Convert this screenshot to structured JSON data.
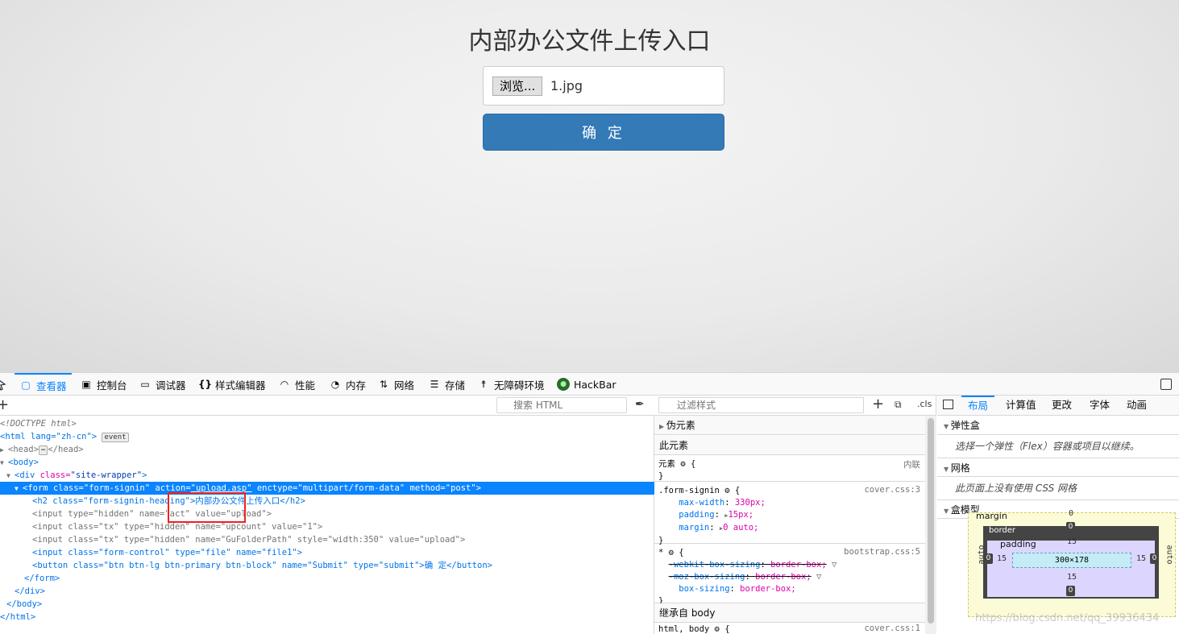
{
  "page": {
    "title": "内部办公文件上传入口",
    "browse_label": "浏览...",
    "file_name": "1.jpg",
    "submit_label": "确 定"
  },
  "devtools": {
    "tabs": [
      {
        "label": "查看器",
        "icon": "inspector-icon"
      },
      {
        "label": "控制台",
        "icon": "console-icon"
      },
      {
        "label": "调试器",
        "icon": "debugger-icon"
      },
      {
        "label": "样式编辑器",
        "icon": "style-editor-icon"
      },
      {
        "label": "性能",
        "icon": "performance-icon"
      },
      {
        "label": "内存",
        "icon": "memory-icon"
      },
      {
        "label": "网络",
        "icon": "network-icon"
      },
      {
        "label": "存储",
        "icon": "storage-icon"
      },
      {
        "label": "无障碍环境",
        "icon": "accessibility-icon"
      },
      {
        "label": "HackBar",
        "icon": "hackbar-icon"
      }
    ],
    "html_search_placeholder": "搜索 HTML",
    "html_tree": {
      "doctype": "<!DOCTYPE html>",
      "html_open": "<html lang=\"zh-cn\">",
      "event_badge": "event",
      "head_line": "<head>",
      "head_close": "</head>",
      "body_open": "<body>",
      "div_open_tag": "<div ",
      "div_attr": "class=",
      "div_val": "\"site-wrapper\"",
      "form_tag": "<form ",
      "form_class_attr": "class=",
      "form_class_val": "\"form-signin\"",
      "form_action_attr": " action=",
      "form_action_val": "\"upload.asp\"",
      "form_enctype_attr": " enctype=",
      "form_enctype_val": "\"multipart/form-data\"",
      "form_method_attr": " method=",
      "form_method_val": "\"post\"",
      "form_end": ">",
      "h2_line": "<h2 class=\"form-signin-heading\">内部办公文件上传入口</h2>",
      "input1": "<input type=\"hidden\" name=\"act\" value=\"upload\">",
      "input2": "<input class=\"tx\" type=\"hidden\" name=\"upcount\" value=\"1\">",
      "input3": "<input class=\"tx\" type=\"hidden\" name=\"GuFolderPath\" style=\"width:350\" value=\"upload\">",
      "input4": "<input class=\"form-control\" type=\"file\" name=\"file1\">",
      "button_line": "<button class=\"btn btn-lg btn-primary btn-block\" name=\"Submit\" type=\"submit\">确 定</button>",
      "form_close": "</form>",
      "div_close": "</div>",
      "body_close": "</body>",
      "html_close": "</html>"
    },
    "rules": {
      "filter_placeholder": "过滤样式",
      "cls_label": ".cls",
      "pseudo_label": "伪元素",
      "this_element_label": "此元素",
      "element_selector": "元素",
      "inline_label": "内联",
      "rule1_selector": ".form-signin",
      "rule1_source": "cover.css:3",
      "rule1_props": [
        {
          "name": "max-width",
          "value": "330px;"
        },
        {
          "name": "padding",
          "value": "15px;"
        },
        {
          "name": "margin",
          "value": "0 auto;"
        }
      ],
      "rule2_selector": "*",
      "rule2_source": "bootstrap.css:5",
      "rule2_props": [
        {
          "name": "-webkit-box-sizing",
          "value": "border-box;"
        },
        {
          "name": "-moz-box-sizing",
          "value": "border-box;"
        },
        {
          "name": "box-sizing",
          "value": "border-box;"
        }
      ],
      "inherited_label": "继承自 body",
      "rule3_selector": "html, body",
      "rule3_source": "cover.css:1"
    },
    "layout": {
      "tabs": [
        "布局",
        "计算值",
        "更改",
        "字体",
        "动画"
      ],
      "flex_label": "弹性盒",
      "flex_hint": "选择一个弹性（Flex）容器或项目以继续。",
      "grid_label": "网格",
      "grid_hint": "此页面上没有使用 CSS 网格",
      "boxmodel_label": "盒模型",
      "margin_label": "margin",
      "border_label": "border",
      "padding_label": "padding",
      "margin_top": "0",
      "margin_side": "auto",
      "border_val": "0",
      "padding_val": "15",
      "content_size": "300×178"
    },
    "watermark": "https://blog.csdn.net/qq_39936434"
  }
}
